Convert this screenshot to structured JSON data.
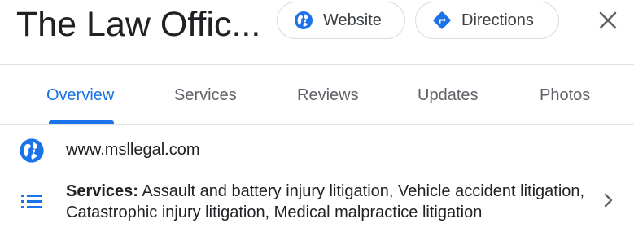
{
  "header": {
    "title": "The Law Offic...",
    "website_label": "Website",
    "directions_label": "Directions",
    "website_icon": "globe-icon",
    "directions_icon": "directions-icon",
    "close_icon": "close-icon"
  },
  "tabs": [
    {
      "label": "Overview",
      "active": true
    },
    {
      "label": "Services",
      "active": false
    },
    {
      "label": "Reviews",
      "active": false
    },
    {
      "label": "Updates",
      "active": false
    },
    {
      "label": "Photos",
      "active": false
    }
  ],
  "details": {
    "website": "www.msllegal.com",
    "services_label": "Services:",
    "services_text": " Assault and battery injury litigation, Vehicle accident litigation, Catastrophic injury litigation, Medical malpractice litigation"
  },
  "colors": {
    "accent": "#1a73e8",
    "text": "#202124",
    "muted": "#5f6368",
    "divider": "#e3e3e3"
  }
}
